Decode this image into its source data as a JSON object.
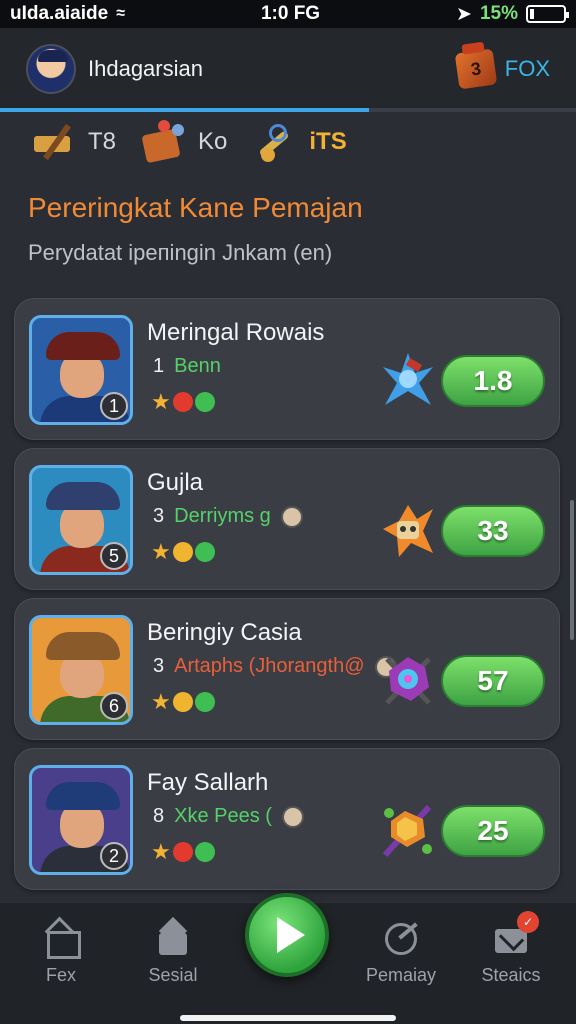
{
  "status_bar": {
    "carrier": "uIda.aiaide",
    "time": "1:0 FG",
    "battery": "15%"
  },
  "header": {
    "username": "Ihdagarsian",
    "currency_label": "FOX",
    "box_label": "3"
  },
  "progress": {
    "fraction": 0.64
  },
  "resources": [
    {
      "icon": "hammer-icon",
      "value": "T8"
    },
    {
      "icon": "gift-icon",
      "value": "Ko"
    },
    {
      "icon": "tools-icon",
      "value": "iTS"
    }
  ],
  "page": {
    "title": "Pereringkat Kane Pemajan",
    "subtitle": "Perydatat ipeпingin Jnkam (en)"
  },
  "leaderboard": [
    {
      "name": "Meringal Rowais",
      "rank": "1",
      "line_num": "1",
      "line_text": "Benn",
      "line_color": "#56d16a",
      "score": "1.8",
      "gems": [
        "red",
        "green"
      ],
      "portrait": {
        "bg": "#2a5fa8",
        "hat": "#6a1f1a",
        "body": "#1c3a78"
      }
    },
    {
      "name": "Gujla",
      "rank": "5",
      "line_num": "3",
      "line_text": "Derriyms g",
      "line_color": "#56d16a",
      "score": "33",
      "gems": [
        "gold",
        "green"
      ],
      "portrait": {
        "bg": "#2c8bbf",
        "hat": "#2f3f6e",
        "body": "#8a2a1e"
      }
    },
    {
      "name": "Beringiy Casia",
      "rank": "6",
      "line_num": "3",
      "line_text": "Artaphs (Jhorangth@",
      "line_color": "#e8603a",
      "score": "57",
      "gems": [
        "gold",
        "green"
      ],
      "portrait": {
        "bg": "#e89a3a",
        "hat": "#8a5a2a",
        "body": "#3f6a2a"
      }
    },
    {
      "name": "Fay Sallarh",
      "rank": "2",
      "line_num": "8",
      "line_text": "Xke Pees (",
      "line_color": "#56d16a",
      "score": "25",
      "gems": [
        "red",
        "green"
      ],
      "portrait": {
        "bg": "#4a3f8a",
        "hat": "#1f3c78",
        "body": "#2a2f3a"
      }
    }
  ],
  "nav": {
    "items": [
      {
        "label": "Fex",
        "icon": "home-outline-icon"
      },
      {
        "label": "Sesial",
        "icon": "house-icon"
      },
      {
        "label": "Pemaiay",
        "icon": "target-icon"
      },
      {
        "label": "Steaics",
        "icon": "mail-icon",
        "badge": "✓"
      }
    ]
  }
}
